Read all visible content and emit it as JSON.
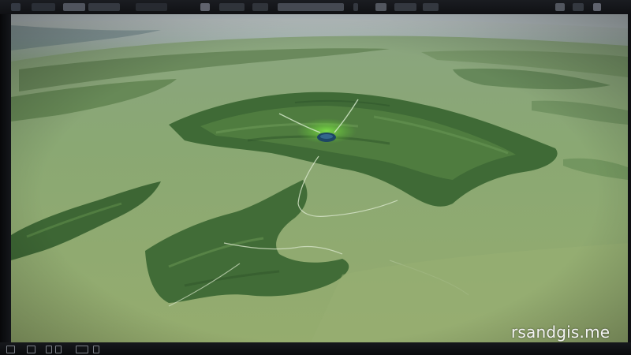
{
  "watermark": {
    "text": "rsandgis.me"
  },
  "viewport": {
    "content": "aerial-landscape-image"
  },
  "colors": {
    "water": "#8fa977",
    "land_dark": "#3f6a36",
    "land_mid": "#5e8a48",
    "sky_haze": "#aebac0",
    "lake": "#1d4664",
    "highlight": "#6fd23c",
    "bezel": "#0c0d10"
  },
  "icons": {
    "topbar": [
      "app-icon",
      "menu-item",
      "menu-item",
      "menu-item",
      "menu-item",
      "toolbar-icon",
      "menu-item",
      "menu-item",
      "window-title",
      "toolbar-icon",
      "toolbar-icon",
      "menu-item",
      "menu-item",
      "tray-icon",
      "tray-icon",
      "tray-icon"
    ],
    "bottombar": [
      "grid-icon",
      "layers-icon",
      "zoom-in-icon",
      "zoom-out-icon",
      "ruler-icon",
      "settings-icon"
    ]
  }
}
